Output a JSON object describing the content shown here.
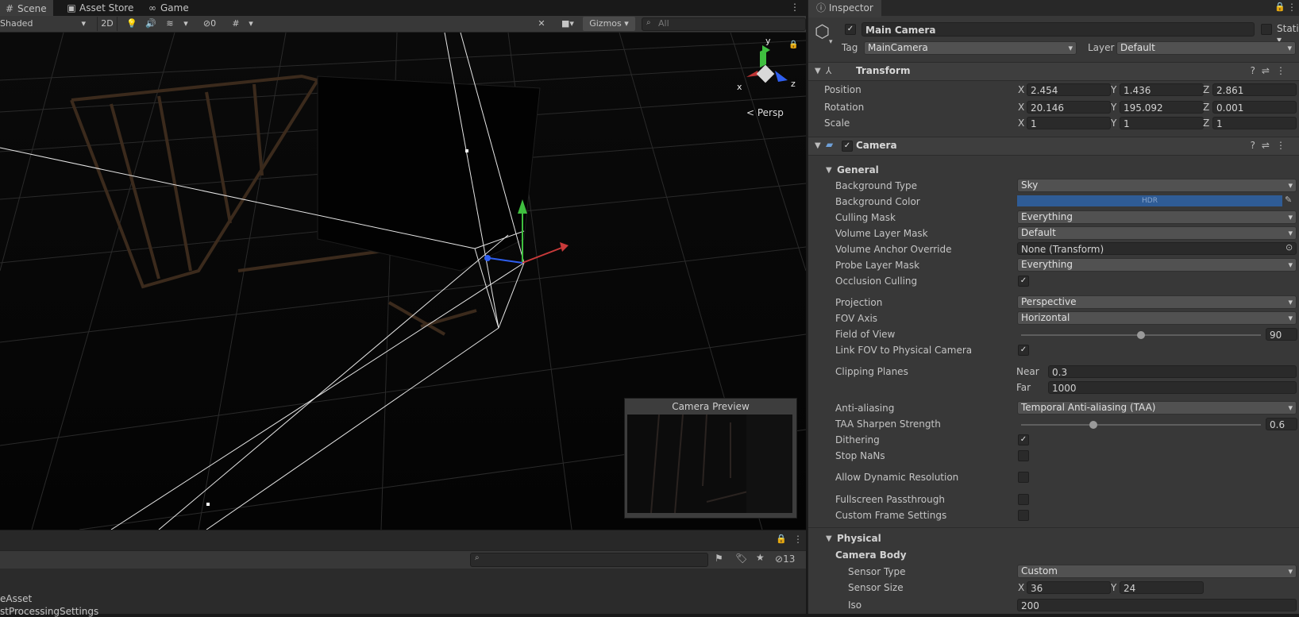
{
  "scene_tabs": [
    {
      "label": "Scene",
      "icon": "grid-icon"
    },
    {
      "label": "Asset Store",
      "icon": "store-icon"
    },
    {
      "label": "Game",
      "icon": "gamepad-icon"
    }
  ],
  "scene_toolbar": {
    "draw_mode": "Shaded",
    "mode_2d": "2D",
    "hidden_count": "0",
    "gizmos": "Gizmos",
    "search_placeholder": "All"
  },
  "gizmo_labels": {
    "y": "y",
    "x": "x",
    "z": "z",
    "persp": "< Persp"
  },
  "camera_preview": {
    "title": "Camera Preview"
  },
  "bottom_bar": {
    "layer_count": "13"
  },
  "asset_list": [
    "eAsset",
    "stProcessingSettings"
  ],
  "inspector": {
    "tab_label": "Inspector",
    "object_name": "Main Camera",
    "static_label": "Static",
    "tag_label": "Tag",
    "tag_value": "MainCamera",
    "layer_label": "Layer",
    "layer_value": "Default",
    "transform": {
      "title": "Transform",
      "position": {
        "label": "Position",
        "x": "2.454",
        "y": "1.436",
        "z": "2.861"
      },
      "rotation": {
        "label": "Rotation",
        "x": "20.146",
        "y": "195.092",
        "z": "0.001"
      },
      "scale": {
        "label": "Scale",
        "x": "1",
        "y": "1",
        "z": "1"
      }
    },
    "camera": {
      "title": "Camera",
      "general_label": "General",
      "background_type": {
        "label": "Background Type",
        "value": "Sky"
      },
      "background_color": {
        "label": "Background Color",
        "value": "HDR",
        "color": "#2f5c96"
      },
      "culling_mask": {
        "label": "Culling Mask",
        "value": "Everything"
      },
      "volume_layer_mask": {
        "label": "Volume Layer Mask",
        "value": "Default"
      },
      "volume_anchor_override": {
        "label": "Volume Anchor Override",
        "value": "None (Transform)"
      },
      "probe_layer_mask": {
        "label": "Probe Layer Mask",
        "value": "Everything"
      },
      "occlusion_culling": {
        "label": "Occlusion Culling",
        "checked": true
      },
      "projection": {
        "label": "Projection",
        "value": "Perspective"
      },
      "fov_axis": {
        "label": "FOV Axis",
        "value": "Horizontal"
      },
      "field_of_view": {
        "label": "Field of View",
        "value": "90",
        "slider_fraction": 0.5
      },
      "link_fov": {
        "label": "Link FOV to Physical Camera",
        "checked": true
      },
      "clipping_planes": {
        "label": "Clipping Planes",
        "near_label": "Near",
        "near": "0.3",
        "far_label": "Far",
        "far": "1000"
      },
      "anti_aliasing": {
        "label": "Anti-aliasing",
        "value": "Temporal Anti-aliasing (TAA)"
      },
      "taa_sharpen": {
        "label": "TAA Sharpen Strength",
        "value": "0.6",
        "slider_fraction": 0.3
      },
      "dithering": {
        "label": "Dithering",
        "checked": true
      },
      "stop_nans": {
        "label": "Stop NaNs",
        "checked": false
      },
      "allow_dynamic_resolution": {
        "label": "Allow Dynamic Resolution",
        "checked": false
      },
      "fullscreen_passthrough": {
        "label": "Fullscreen Passthrough",
        "checked": false
      },
      "custom_frame_settings": {
        "label": "Custom Frame Settings",
        "checked": false
      },
      "physical_label": "Physical",
      "camera_body_label": "Camera Body",
      "sensor_type": {
        "label": "Sensor Type",
        "value": "Custom"
      },
      "sensor_size": {
        "label": "Sensor Size",
        "x": "36",
        "y": "24"
      },
      "iso": {
        "label": "Iso",
        "value": "200"
      }
    }
  }
}
